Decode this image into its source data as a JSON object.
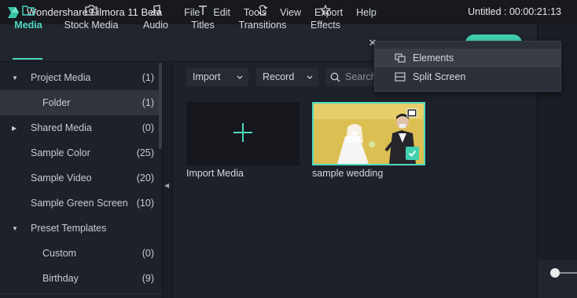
{
  "titlebar": {
    "app_name": "Wondershare Filmora 11 Beta",
    "menu": [
      "File",
      "Edit",
      "Tools",
      "View",
      "Export",
      "Help"
    ],
    "project": "Untitled : 00:00:21:13"
  },
  "tabs": [
    {
      "label": "Media",
      "icon": "folder-icon",
      "active": true
    },
    {
      "label": "Stock Media",
      "icon": "stock-media-icon",
      "active": false
    },
    {
      "label": "Audio",
      "icon": "music-note-icon",
      "active": false
    },
    {
      "label": "Titles",
      "icon": "text-t-icon",
      "active": false
    },
    {
      "label": "Transitions",
      "icon": "transition-icon",
      "active": false
    },
    {
      "label": "Effects",
      "icon": "effects-icon",
      "active": false
    }
  ],
  "collapse_glyph": "✕",
  "accent": "#4fd8bf",
  "sidebar": {
    "items": [
      {
        "label": "Project Media",
        "count": "(1)",
        "arrow": "▼"
      },
      {
        "label": "Folder",
        "count": "(1)",
        "arrow": ""
      },
      {
        "label": "Shared Media",
        "count": "(0)",
        "arrow": "▶"
      },
      {
        "label": "Sample Color",
        "count": "(25)",
        "arrow": ""
      },
      {
        "label": "Sample Video",
        "count": "(20)",
        "arrow": ""
      },
      {
        "label": "Sample Green Screen",
        "count": "(10)",
        "arrow": ""
      },
      {
        "label": "Preset Templates",
        "count": "",
        "arrow": "▼"
      },
      {
        "label": "Custom",
        "count": "(0)",
        "arrow": ""
      },
      {
        "label": "Birthday",
        "count": "(9)",
        "arrow": ""
      }
    ]
  },
  "toolbar": {
    "import_label": "Import",
    "record_label": "Record",
    "search_placeholder": "Search"
  },
  "media": {
    "import_label": "Import Media",
    "clip_label": "sample wedding"
  },
  "dropdown": {
    "items": [
      {
        "label": "Elements",
        "icon": "elements-icon"
      },
      {
        "label": "Split Screen",
        "icon": "split-screen-icon"
      }
    ]
  }
}
